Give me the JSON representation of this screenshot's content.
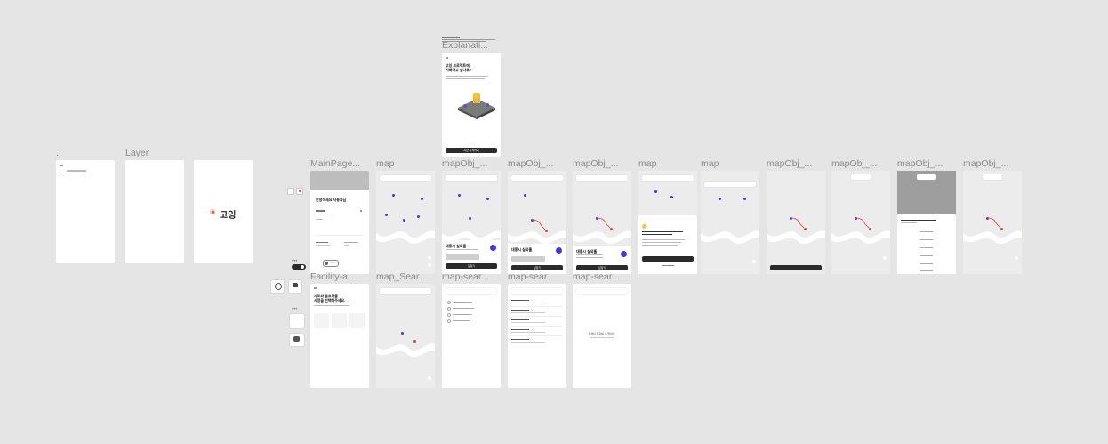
{
  "labels": {
    "dot_label": ".",
    "layer": "Layer",
    "explanation": "Explanati...",
    "mainpage": "MainPage...",
    "map1": "map",
    "mapobj1": "mapObj_...",
    "mapobj2": "mapObj_...",
    "mapobj3": "mapObj_...",
    "map2": "map",
    "map3": "map",
    "mapobj4": "mapObj_...",
    "mapobj5": "mapObj_...",
    "mapobj6": "mapObj_...",
    "mapobj7": "mapObj_...",
    "facility": "Facility-a...",
    "mapsearch1": "map_Sear...",
    "mapsearch2": "map-sear...",
    "mapsearch3": "map-sear...",
    "mapsearch4": "map-sear..."
  },
  "splash": {
    "text": "고잉"
  },
  "explanation_screen": {
    "title_line1": "고잉 프로젝트에",
    "title_line2": "기뻐하고 싶나요?",
    "button": "지금 시작하기"
  },
  "mainpage_screen": {
    "greeting": "안녕하세요 사용자님",
    "toggle_label": "ON"
  },
  "bottom_sheet": {
    "place_name": "대흥시 실외홀",
    "button": "길찾기"
  },
  "facility_screen": {
    "title_line1": "자도와 필요하을",
    "title_line2": "사정을 선택해주세요."
  },
  "empty_search": {
    "message": "검색어 결과를 수 없어요."
  },
  "colors": {
    "canvas": "#e5e5e5",
    "accent_blue": "#3b3be0",
    "accent_red": "#e04040",
    "dark_button": "#2b2b2b"
  }
}
